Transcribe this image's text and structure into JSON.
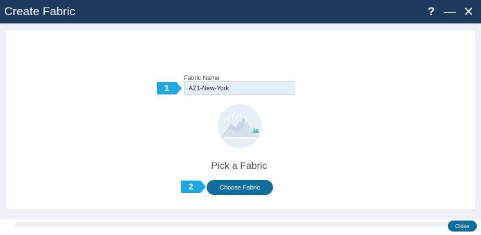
{
  "window": {
    "title": "Create Fabric",
    "help_glyph": "?",
    "minimize_glyph": "—",
    "close_glyph": "✕"
  },
  "form": {
    "fabric_name_label": "Fabric Name",
    "fabric_name_value": "AZ1-New-York",
    "step1": "1",
    "step2": "2"
  },
  "picker": {
    "title": "Pick a Fabric",
    "choose_button": "Choose Fabric"
  },
  "footer": {
    "close_button": "Close"
  },
  "colors": {
    "titlebar": "#1f3a5f",
    "step_badge": "#1fa7e0",
    "primary_button": "#0f6e9a"
  }
}
